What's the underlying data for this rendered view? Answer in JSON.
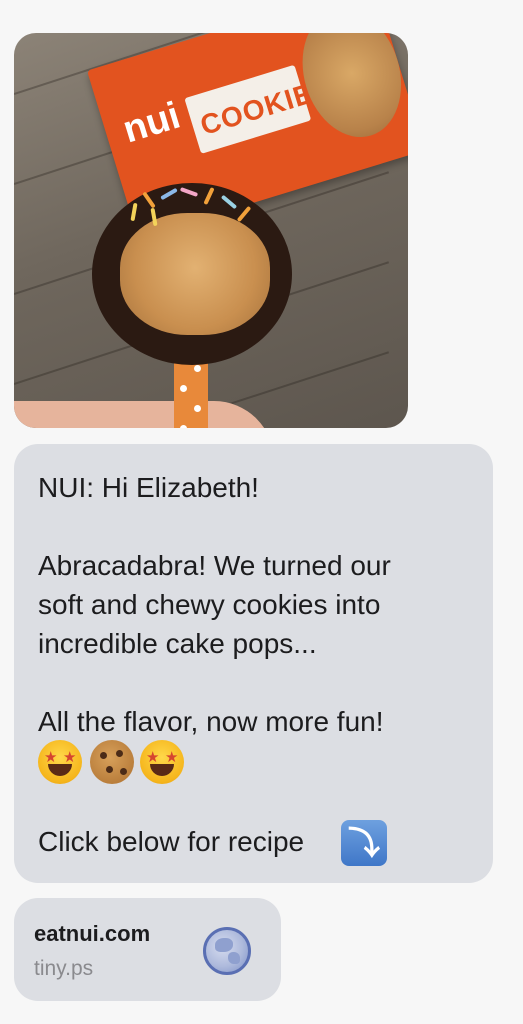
{
  "message": {
    "image": {
      "alt_name": "cake-pop-photo",
      "package_brand": "nui",
      "package_label": "COOKIE"
    },
    "text_lines": [
      "NUI: Hi Elizabeth!",
      "Abracadabra! We turned our",
      "soft and chewy cookies into",
      "incredible cake pops...",
      "All the flavor, now more fun!",
      "Click below for recipe"
    ],
    "emojis": [
      "star-struck",
      "cookie",
      "star-struck"
    ],
    "arrow_icon": "arrow-down-right-icon"
  },
  "link_preview": {
    "domain": "eatnui.com",
    "short_url": "tiny.ps",
    "icon": "globe-icon"
  }
}
